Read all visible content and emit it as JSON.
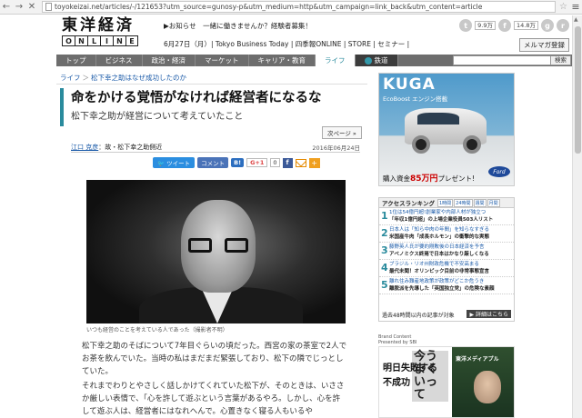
{
  "browser": {
    "url": "toyokeizai.net/articles/-/121653?utm_source=gunosy-p&utm_medium=http&utm_campaign=link_back&utm_content=article"
  },
  "header": {
    "logo_main": "東洋経済",
    "logo_sub": [
      "O",
      "N",
      "L",
      "I",
      "N",
      "E"
    ],
    "promo": "▶お知らせ　一緒に働きませんか？経験者募集！",
    "date": "6月27日（月）",
    "links": "| Tokyo Business Today | 四季報ONLINE | STORE | セミナー |",
    "social": {
      "twitter_count": "9.9万",
      "facebook_count": "14.8万"
    },
    "mail_button": "メルマガ登録"
  },
  "nav": {
    "items": [
      "トップ",
      "ビジネス",
      "政治・経済",
      "マーケット",
      "キャリア・教育",
      "ライフ"
    ],
    "active": "ライフ",
    "rail": "鉄道",
    "search_button": "検索"
  },
  "breadcrumb": {
    "items": [
      "ライフ",
      "松下幸之助はなぜ成功したのか"
    ],
    "sep": "＞"
  },
  "article": {
    "title": "命をかける覚悟がなければ経営者になるな",
    "subtitle": "松下幸之助が経営について考えていたこと",
    "next_page": "次ページ »",
    "author": "江口 克彦",
    "author_role": "：故・松下幸之助側近",
    "date": "2016年06月24日",
    "share": {
      "tweet": "ツイート",
      "comment": "コメント",
      "hatena": "B!",
      "gplus": "G+1",
      "gplus_count": "0",
      "fb": "f"
    },
    "caption": "いつも経営のことを考えている人であった（撮影者不明）",
    "paragraphs": [
      "松下幸之助のそばについて7年目ぐらいの頃だった。西宮の家の茶室で2人でお茶を飲んでいた。当時の私はまだまだ緊張しており、松下の隣でじっとしていた。",
      "それまでわりとやさしく話しかけてくれていた松下が、そのときは、いささか厳しい表情で、「心を許して遊ぶという言葉があるやろ。しかし、心を許して遊ぶ人は、経営者にはなれへんで。心置きなく寝る人もいるや"
    ]
  },
  "sidebar": {
    "ad": {
      "title": "KUGA",
      "sub": "EcoBoost エンジン搭載",
      "offer_prefix": "購入資金",
      "offer_amount": "85万円",
      "offer_suffix": "プレゼント!",
      "brand": "Ford"
    },
    "ranking": {
      "title": "アクセスランキング",
      "tabs": [
        "1時間",
        "24時間",
        "週間",
        "月間"
      ],
      "items": [
        {
          "num": "1",
          "line1": "1位は54億円超!創業家や内部人材が独立つ",
          "line2": "「年収1億円超」の上場企業役員503人リスト"
        },
        {
          "num": "2",
          "line1": "日本人は「知ら中肉の年間」を知らなすぎる",
          "line2": "米国産牛肉「成長ホルモン」の衝撃的な実態"
        },
        {
          "num": "3",
          "line1": "藤野英人氏が要約剛敗後の日本経済を予言",
          "line2": "アベノミクス終焉で日本はかなり厳しくなる"
        },
        {
          "num": "4",
          "line1": "ブラジル・リオ州財政危機で不安高まる",
          "line2": "最代未聞！オリンピック目前の非常事態宣言"
        },
        {
          "num": "5",
          "line1": "離れ住み難産地政策が政策がどこか危うき",
          "line2": "離脱派を先導した「英国独立党」の危険な素顔"
        }
      ],
      "footer": "過去48時間以内の記事が対象",
      "more": "▶ 詳細はこちら"
    },
    "brand_content": {
      "label_line1": "Brand Content",
      "label_line2": "Presented by SBI",
      "text_a": "今うまくいって",
      "text_b": "明日失敗する",
      "text_c": "不成功",
      "magazine": "東洋メディアプル"
    }
  },
  "colors": {
    "accent": "#2a8b9d",
    "nav_bg": "#6d6d6d",
    "link": "#1a5aa8"
  }
}
